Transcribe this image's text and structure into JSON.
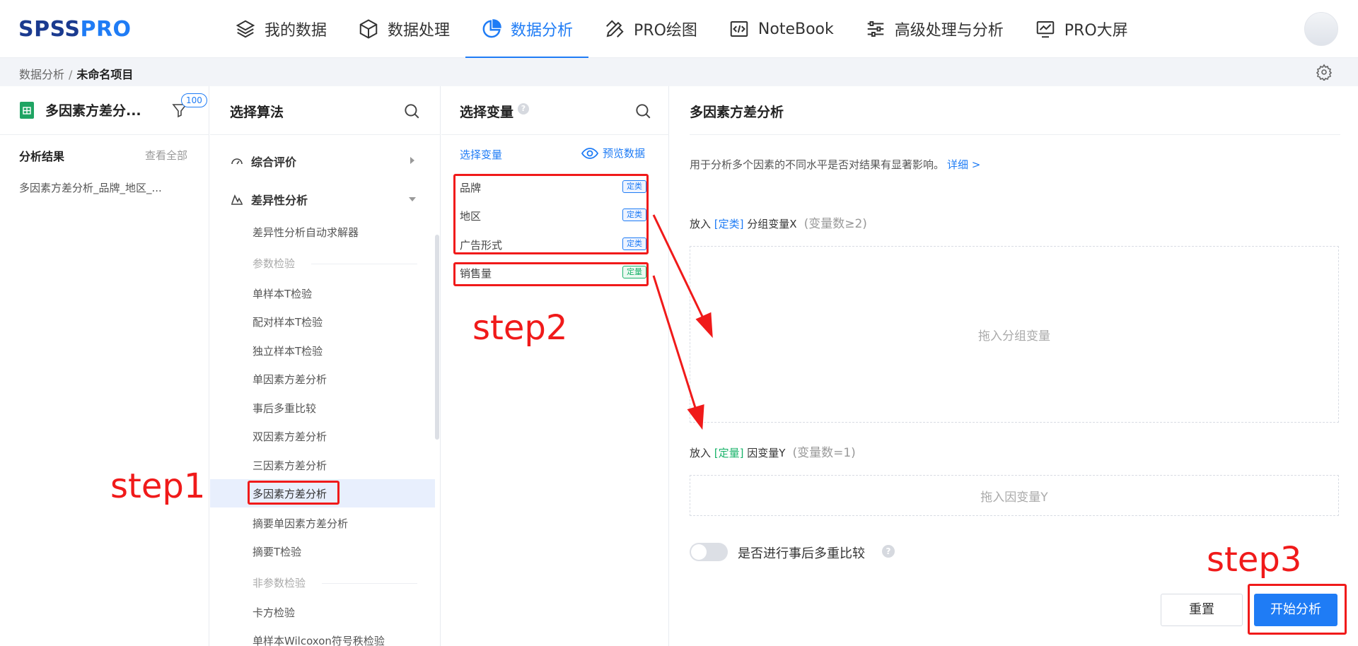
{
  "header": {
    "logo_part1": "SPSS",
    "logo_part2": "PRO",
    "nav": [
      {
        "label": "我的数据"
      },
      {
        "label": "数据处理"
      },
      {
        "label": "数据分析"
      },
      {
        "label": "PRO绘图"
      },
      {
        "label": "NoteBook"
      },
      {
        "label": "高级处理与分析"
      },
      {
        "label": "PRO大屏"
      }
    ]
  },
  "breadcrumb": {
    "parent": "数据分析",
    "sep": "/",
    "current": "未命名项目"
  },
  "project": {
    "title": "多因素方差分...",
    "filter_badge": "100",
    "results_heading": "分析结果",
    "view_all": "查看全部",
    "result_item": "多因素方差分析_品牌_地区_..."
  },
  "algorithms": {
    "title": "选择算法",
    "groups": [
      {
        "label": "综合评价"
      },
      {
        "label": "差异性分析"
      }
    ],
    "items": [
      "差异性分析自动求解器",
      "单样本T检验",
      "配对样本T检验",
      "独立样本T检验",
      "单因素方差分析",
      "事后多重比较",
      "双因素方差分析",
      "三因素方差分析",
      "多因素方差分析",
      "摘要单因素方差分析",
      "摘要T检验",
      "卡方检验",
      "单样本Wilcoxon符号秩检验"
    ],
    "categories": [
      "参数检验",
      "非参数检验"
    ]
  },
  "variables": {
    "title": "选择变量",
    "tab_label": "选择变量",
    "preview_label": "预览数据",
    "list": [
      {
        "name": "品牌",
        "tag": "定类"
      },
      {
        "name": "地区",
        "tag": "定类"
      },
      {
        "name": "广告形式",
        "tag": "定类"
      },
      {
        "name": "销售量",
        "tag": "定量"
      }
    ]
  },
  "config": {
    "title": "多因素方差分析",
    "description": "用于分析多个因素的不同水平是否对结果有显著影响。",
    "detail_link": "详细 >",
    "x_label_prefix": "放入",
    "x_label_type": "[定类]",
    "x_label_name": "分组变量X",
    "x_hint": "(变量数≥2)",
    "x_drop": "拖入分组变量",
    "y_label_prefix": "放入",
    "y_label_type": "[定量]",
    "y_label_name": "因变量Y",
    "y_hint": "(变量数=1)",
    "y_drop": "拖入因变量Y",
    "toggle_label": "是否进行事后多重比较",
    "reset_label": "重置",
    "start_label": "开始分析"
  },
  "annotations": {
    "step1": "step1",
    "step2": "step2",
    "step3": "step3"
  },
  "colors": {
    "accent": "#1f7cf5",
    "annotation": "#f01a1a",
    "quant_green": "#19b36a"
  }
}
